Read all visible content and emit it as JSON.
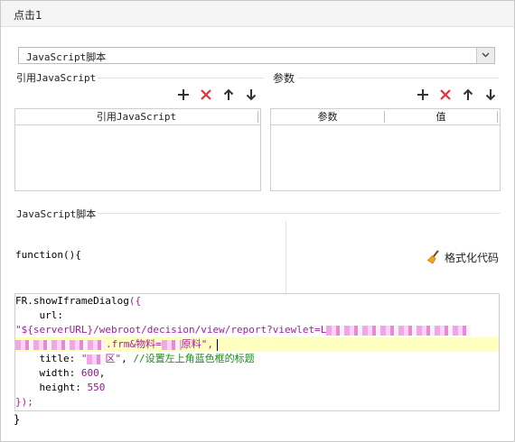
{
  "window": {
    "title": "点击1"
  },
  "script_type": {
    "selected": "JavaScript脚本"
  },
  "ref_js": {
    "label": "引用JavaScript",
    "column_header": "引用JavaScript"
  },
  "params": {
    "label": "参数",
    "col_param": "参数",
    "col_value": "值"
  },
  "js_section": {
    "label": "JavaScript脚本",
    "function_header": "function(){",
    "format_button": "格式化代码",
    "code": {
      "line1_a": "FR.showIframeDialog",
      "line1_b": "({",
      "line2": "    url:",
      "line3": "\"${serverURL}/webroot/decision/view/report?viewlet=L",
      "line4_a": ".frm&物料=",
      "line4_b": "原料\",",
      "line5_a": "    title: ",
      "line5_b": "\"",
      "line5_c": "区\"",
      "line5_d": ", ",
      "line5_e": "//设置左上角蓝色框的标题",
      "line6_a": "    width: ",
      "line6_b": "600",
      "line6_c": ",",
      "line7_a": "    height: ",
      "line7_b": "550",
      "line8": "});"
    },
    "closing": "}"
  },
  "colors": {
    "delete_red": "#e8323a",
    "string_magenta": "#a21ca2",
    "comment_green": "#1a8a1a",
    "highlight_line": "#ffffc0"
  }
}
